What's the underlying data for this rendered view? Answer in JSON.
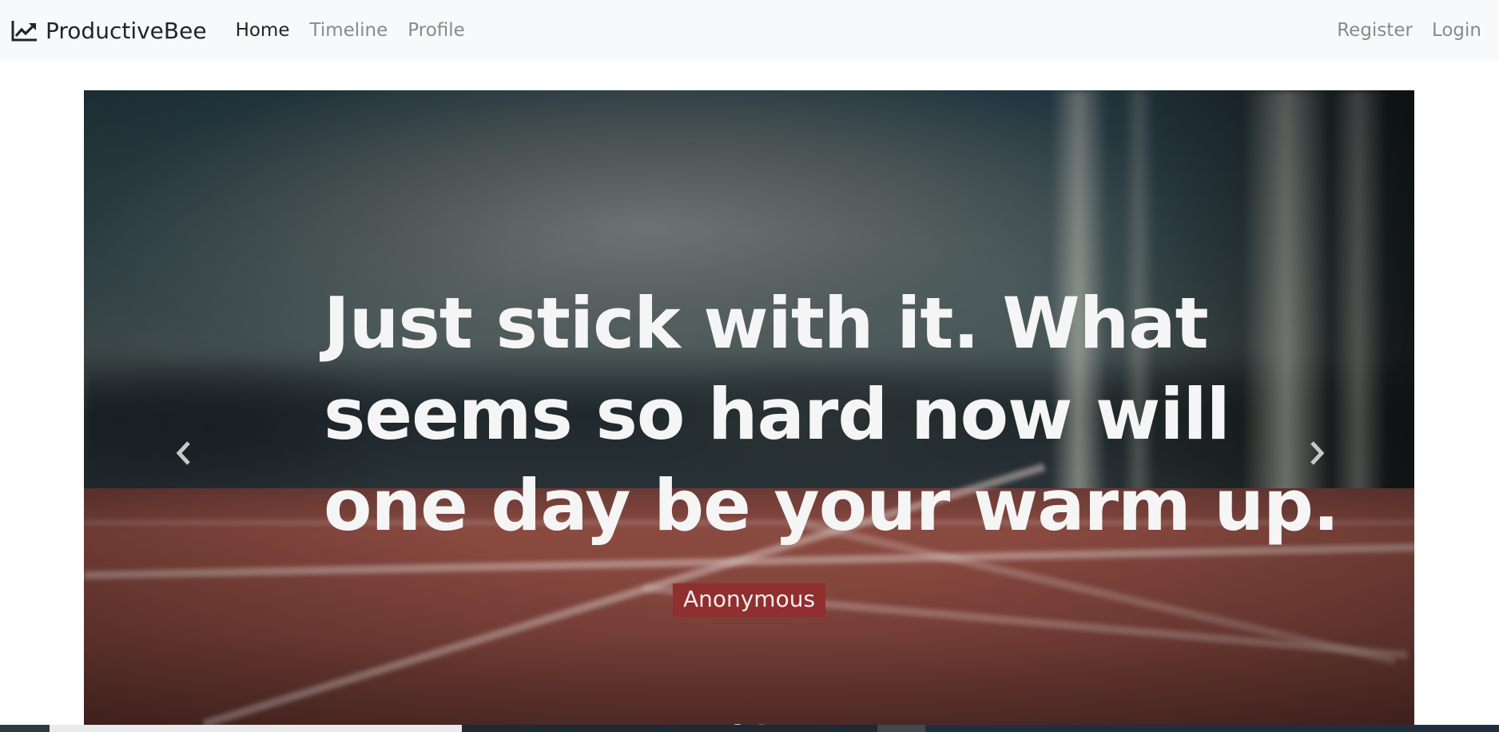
{
  "navbar": {
    "brand": "ProductiveBee",
    "brand_icon": "chart-line-icon",
    "links_left": [
      {
        "label": "Home",
        "active": true
      },
      {
        "label": "Timeline",
        "active": false
      },
      {
        "label": "Profile",
        "active": false
      }
    ],
    "links_right": [
      {
        "label": "Register"
      },
      {
        "label": "Login"
      }
    ]
  },
  "hero": {
    "quote_lines": [
      "Just stick with it. What",
      "seems so hard now will",
      "one day be your warm up."
    ],
    "author": "Anonymous",
    "prev_icon": "chevron-left-icon",
    "next_icon": "chevron-right-icon",
    "author_badge_color": "#8f2f2f"
  }
}
